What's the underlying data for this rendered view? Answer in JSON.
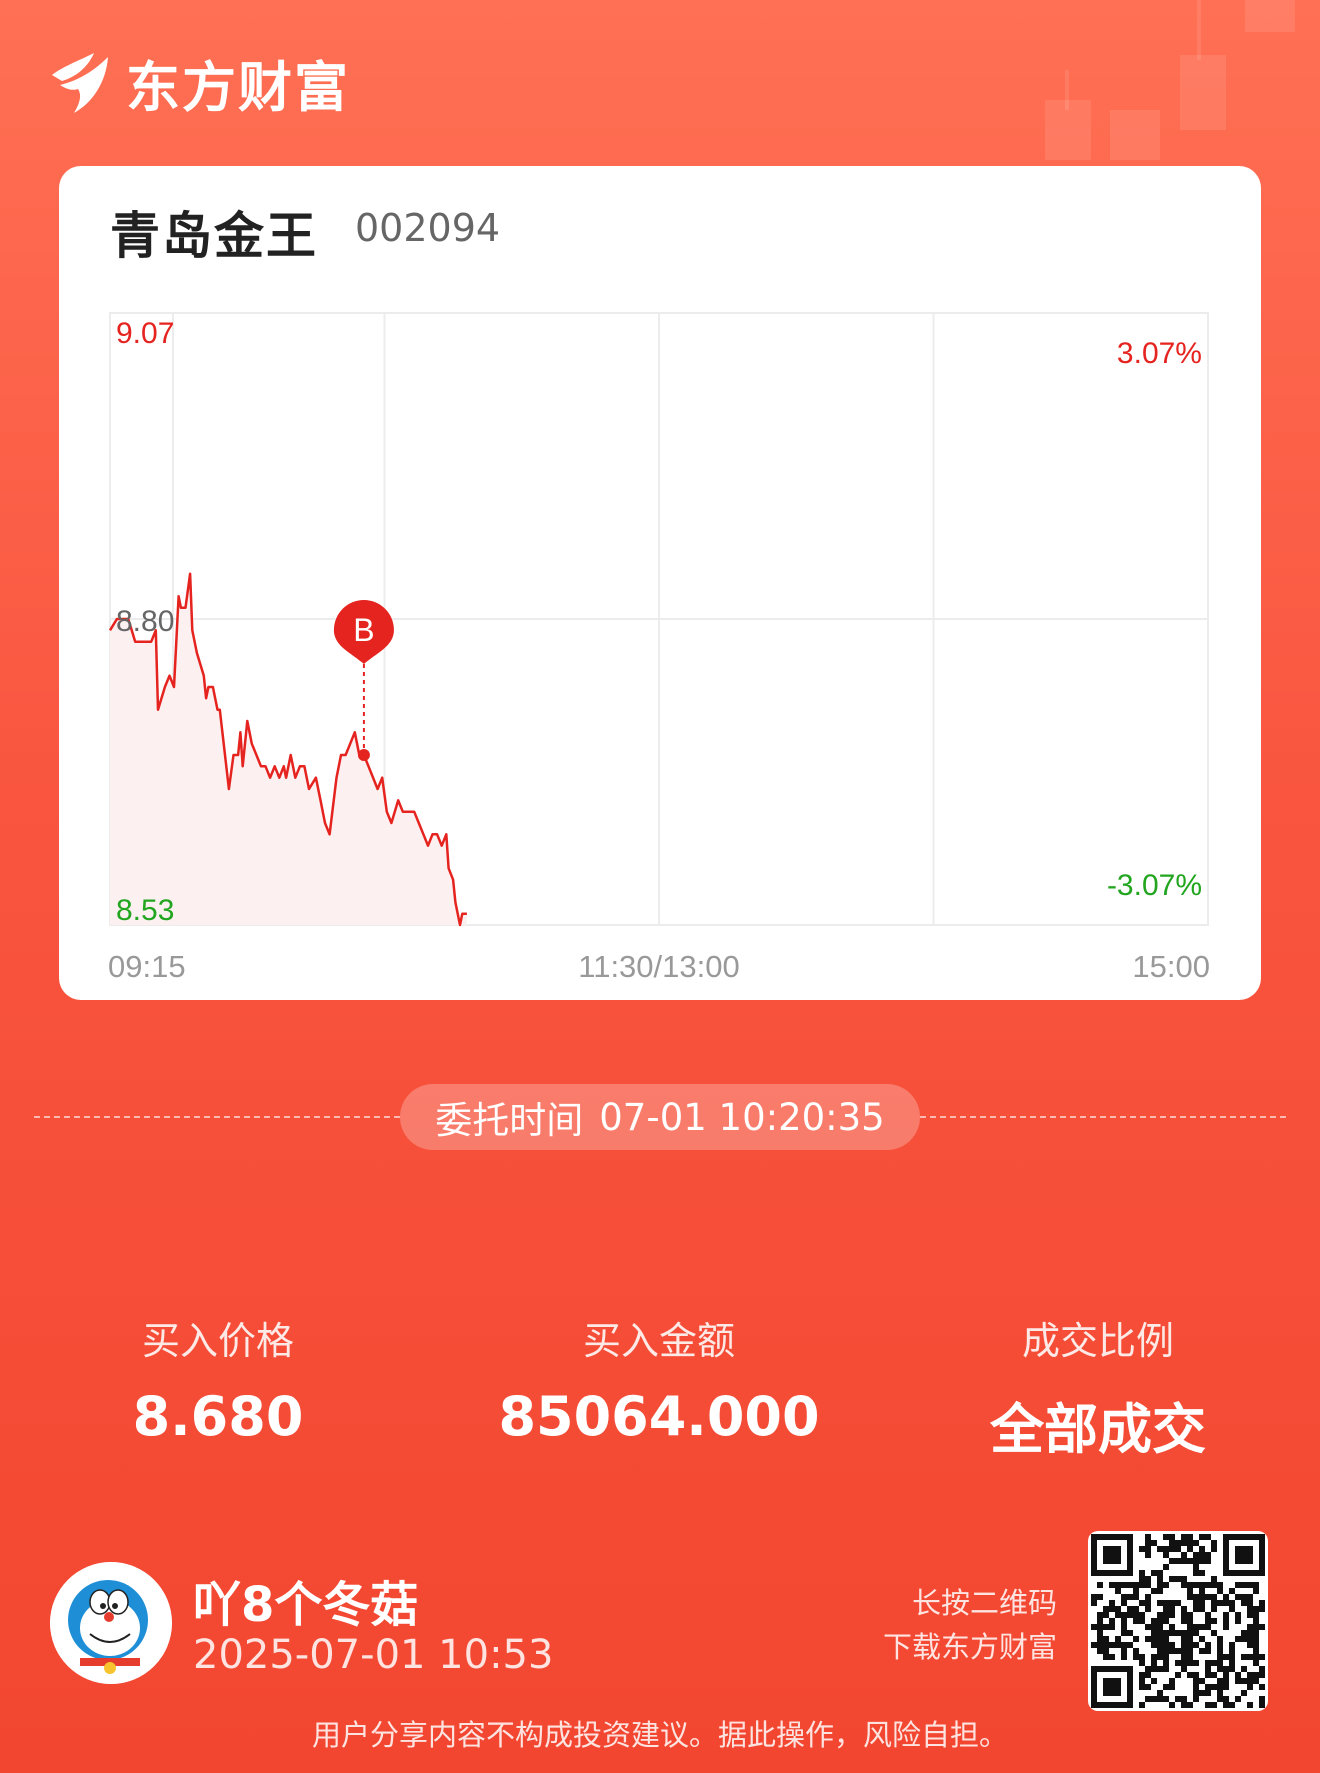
{
  "brand": {
    "name": "东方财富"
  },
  "stock": {
    "name": "青岛金王",
    "code": "002094"
  },
  "chart_data": {
    "type": "line",
    "title": "",
    "y_left_labels": {
      "top": "9.07",
      "mid": "8.80",
      "bottom": "8.53"
    },
    "y_right_labels": {
      "top": "3.07%",
      "bottom": "-3.07%"
    },
    "x_labels": [
      "09:15",
      "11:30/13:00",
      "15:00"
    ],
    "ylim": [
      8.53,
      9.07
    ],
    "prev_close": 8.8,
    "colors": {
      "line": "#e5231f",
      "fill": "#fdf0f0",
      "grid": "#ececec",
      "up_text": "#e5231f",
      "down_text": "#22a51f",
      "axis_text": "#999999"
    },
    "series": [
      {
        "values": [
          [
            0,
            8.79
          ],
          [
            3,
            8.8
          ],
          [
            8,
            8.8
          ],
          [
            11,
            8.78
          ],
          [
            13,
            8.78
          ],
          [
            18,
            8.78
          ],
          [
            20,
            8.79
          ],
          [
            21,
            8.72
          ],
          [
            24,
            8.74
          ],
          [
            26,
            8.75
          ],
          [
            28,
            8.74
          ],
          [
            30,
            8.82
          ],
          [
            31,
            8.81
          ],
          [
            33,
            8.81
          ],
          [
            35,
            8.84
          ],
          [
            36,
            8.79
          ],
          [
            38,
            8.77
          ],
          [
            41,
            8.75
          ],
          [
            42,
            8.73
          ],
          [
            43,
            8.74
          ],
          [
            45,
            8.74
          ],
          [
            47,
            8.72
          ],
          [
            48,
            8.72
          ],
          [
            52,
            8.65
          ],
          [
            54,
            8.68
          ],
          [
            56,
            8.68
          ],
          [
            57,
            8.7
          ],
          [
            58,
            8.67
          ],
          [
            60,
            8.71
          ],
          [
            62,
            8.69
          ],
          [
            64,
            8.68
          ],
          [
            66,
            8.67
          ],
          [
            68,
            8.67
          ],
          [
            70,
            8.66
          ],
          [
            72,
            8.67
          ],
          [
            74,
            8.66
          ],
          [
            76,
            8.67
          ],
          [
            77,
            8.66
          ],
          [
            79,
            8.68
          ],
          [
            81,
            8.66
          ],
          [
            83,
            8.67
          ],
          [
            85,
            8.67
          ],
          [
            87,
            8.65
          ],
          [
            90,
            8.66
          ],
          [
            92,
            8.64
          ],
          [
            94,
            8.62
          ],
          [
            96,
            8.61
          ],
          [
            99,
            8.66
          ],
          [
            101,
            8.68
          ],
          [
            103,
            8.68
          ],
          [
            105,
            8.69
          ],
          [
            107,
            8.7
          ],
          [
            109,
            8.68
          ],
          [
            111,
            8.68
          ],
          [
            113,
            8.67
          ],
          [
            117,
            8.65
          ],
          [
            119,
            8.66
          ],
          [
            121,
            8.63
          ],
          [
            123,
            8.62
          ],
          [
            126,
            8.64
          ],
          [
            128,
            8.63
          ],
          [
            133,
            8.63
          ],
          [
            135,
            8.62
          ],
          [
            137,
            8.61
          ],
          [
            139,
            8.6
          ],
          [
            141,
            8.61
          ],
          [
            143,
            8.61
          ],
          [
            145,
            8.6
          ],
          [
            147,
            8.61
          ],
          [
            148,
            8.58
          ],
          [
            150,
            8.57
          ],
          [
            151,
            8.55
          ],
          [
            153,
            8.53
          ],
          [
            154,
            8.54
          ],
          [
            156,
            8.54
          ]
        ]
      }
    ],
    "trade_marker": {
      "label": "B",
      "x": 111,
      "price": 8.68
    }
  },
  "order": {
    "time_label": "委托时间",
    "time_value": "07-01 10:20:35"
  },
  "stats": [
    {
      "label": "买入价格",
      "value": "8.680"
    },
    {
      "label": "买入金额",
      "value": "85064.000"
    },
    {
      "label": "成交比例",
      "value": "全部成交"
    }
  ],
  "user": {
    "name": "吖8个冬菇",
    "time": "2025-07-01 10:53"
  },
  "qr": {
    "line1": "长按二维码",
    "line2": "下载东方财富"
  },
  "disclaimer": "用户分享内容不构成投资建议。据此操作，风险自担。"
}
